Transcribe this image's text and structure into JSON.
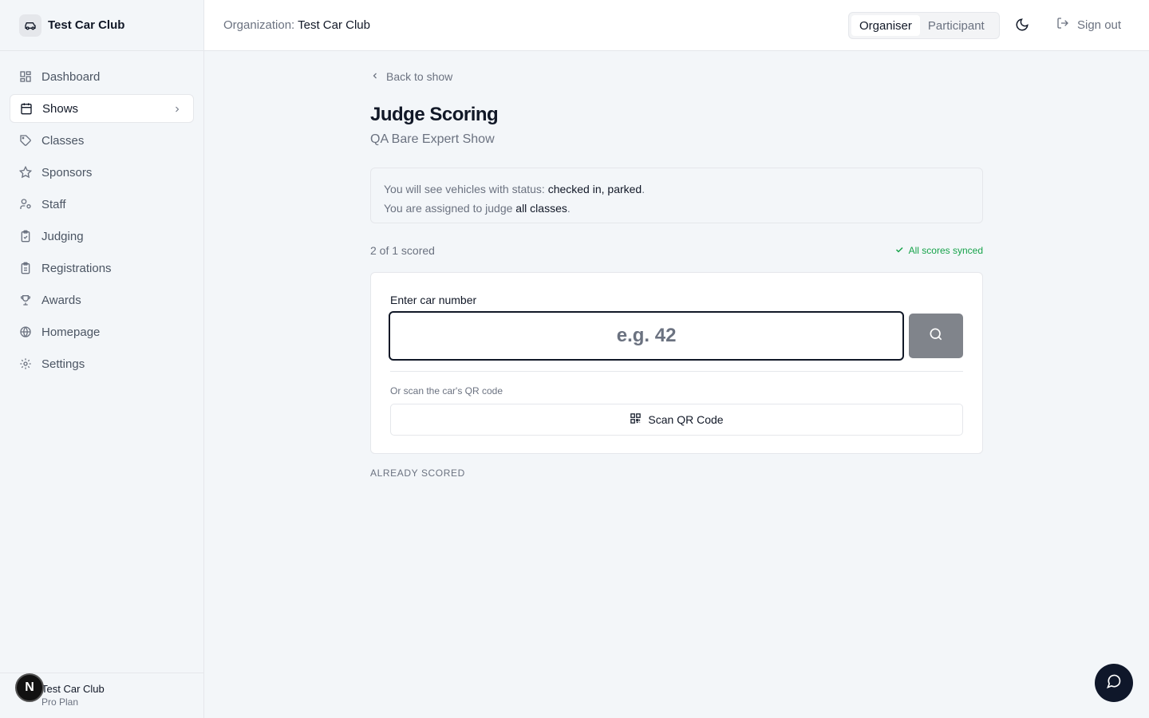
{
  "brand": {
    "name": "Test Car Club",
    "icon": "car-icon"
  },
  "sidebar": {
    "items": [
      {
        "label": "Dashboard",
        "icon": "dashboard-icon"
      },
      {
        "label": "Shows",
        "icon": "calendar-icon",
        "active": true
      },
      {
        "label": "Classes",
        "icon": "tag-icon"
      },
      {
        "label": "Sponsors",
        "icon": "star-icon"
      },
      {
        "label": "Staff",
        "icon": "user-icon"
      },
      {
        "label": "Judging",
        "icon": "clipboard-check-icon"
      },
      {
        "label": "Registrations",
        "icon": "clipboard-icon"
      },
      {
        "label": "Awards",
        "icon": "trophy-icon"
      },
      {
        "label": "Homepage",
        "icon": "globe-icon"
      },
      {
        "label": "Settings",
        "icon": "gear-icon"
      }
    ],
    "footer": {
      "org": "Test Car Club",
      "plan": "Pro Plan",
      "avatar_letter": "N"
    }
  },
  "header": {
    "org_prefix": "Organization:",
    "org_name": "Test Car Club",
    "roles": [
      "Organiser",
      "Participant"
    ],
    "active_role": "Organiser",
    "sign_out": "Sign out"
  },
  "main": {
    "back_label": "Back to show",
    "title": "Judge Scoring",
    "subtitle": "QA Bare Expert Show",
    "info": {
      "line1_prefix": "You will see vehicles with status:",
      "line1_value": "checked in, parked",
      "line1_suffix": ".",
      "line2_prefix": "You are assigned to judge",
      "line2_value": "all classes",
      "line2_suffix": "."
    },
    "scored_count": "2 of 1 scored",
    "sync_status": "All scores synced",
    "card": {
      "label": "Enter car number",
      "placeholder": "e.g. 42",
      "scan_hint": "Or scan the car's QR code",
      "scan_button": "Scan QR Code"
    },
    "already_scored_heading": "ALREADY SCORED"
  },
  "colors": {
    "accent": "#111827",
    "success": "#16a34a",
    "search_button": "#80848b",
    "chat_fab": "#0f172a"
  }
}
